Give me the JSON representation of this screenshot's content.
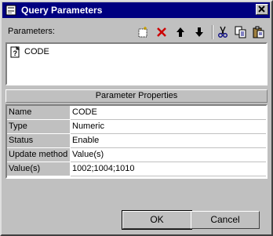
{
  "window": {
    "title": "Query Parameters"
  },
  "parameters": {
    "label": "Parameters:",
    "items": [
      {
        "label": "CODE"
      }
    ]
  },
  "toolbar": {
    "icons": [
      "new-icon",
      "delete-icon",
      "move-up-icon",
      "move-down-icon",
      "cut-icon",
      "copy-icon",
      "paste-icon"
    ]
  },
  "properties": {
    "header": "Parameter Properties",
    "rows": [
      {
        "name": "Name",
        "value": "CODE"
      },
      {
        "name": "Type",
        "value": "Numeric"
      },
      {
        "name": "Status",
        "value": "Enable"
      },
      {
        "name": "Update method",
        "value": "Value(s)"
      },
      {
        "name": "Value(s)",
        "value": "1002;1004;1010"
      }
    ]
  },
  "buttons": {
    "ok": "OK",
    "cancel": "Cancel"
  },
  "colors": {
    "titlebar": "#000080",
    "face": "#c0c0c0",
    "delete_red": "#cc0000"
  }
}
